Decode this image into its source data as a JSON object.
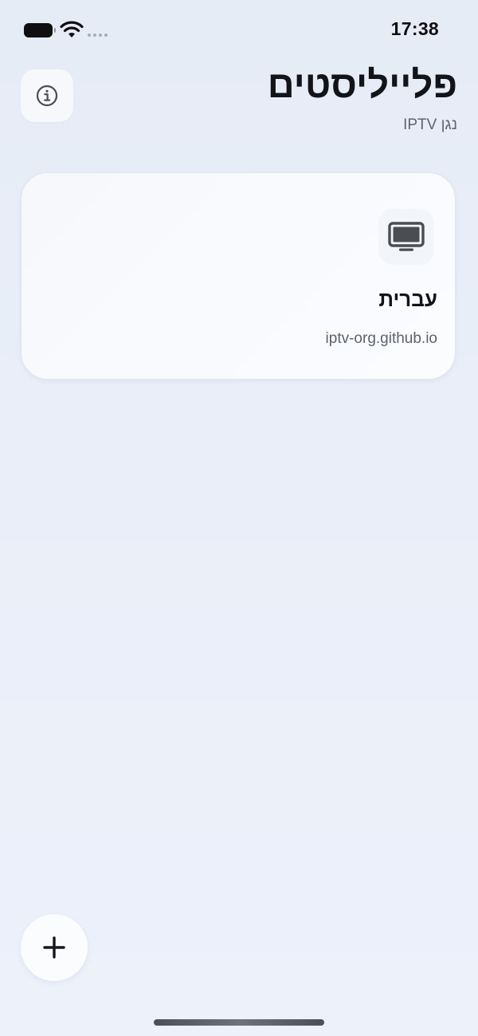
{
  "status_bar": {
    "time": "17:38",
    "icons": [
      "battery-icon",
      "wifi-icon",
      "signal-icon"
    ]
  },
  "header": {
    "title": "פלייליסטים",
    "subtitle": "נגן IPTV",
    "info_icon": "info-icon"
  },
  "playlists": [
    {
      "title": "עברית",
      "source": "iptv-org.github.io",
      "icon": "tv-icon"
    }
  ],
  "actions": {
    "add_icon": "plus-icon"
  },
  "colors": {
    "background": "#e8edf7",
    "card": "#f8fafd",
    "text_primary": "#12141a",
    "text_secondary": "#5f6570",
    "icon": "#4a4d52"
  }
}
